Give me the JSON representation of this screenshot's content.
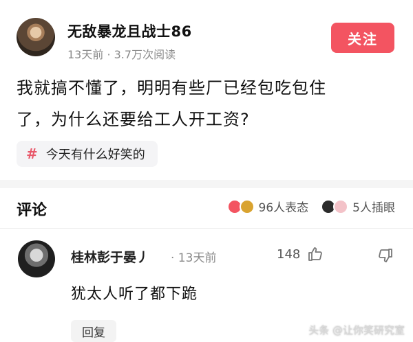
{
  "post": {
    "author_name": "无敌暴龙且战士86",
    "meta": "13天前 · 3.7万次阅读",
    "follow_label": "关注",
    "body_line1": "我就搞不懂了，明明有些厂已经包吃包住",
    "body_line2": "了，为什么还要给工人开工资?",
    "topic_hash": "#",
    "topic": "今天有什么好笑的"
  },
  "comments_section": {
    "title": "评论",
    "reaction_count_label": "96人表态",
    "insert_eye_label": "5人插眼"
  },
  "comment": {
    "user_name": "桂林彭于晏丿",
    "time": "· 13天前",
    "likes": "148",
    "text": "犹太人听了都下跪",
    "reply_label": "回复"
  },
  "watermark": "头条 @让你笑研究室",
  "colors": {
    "follow_bg": "#f35461",
    "topic_hash": "#e8586a",
    "muted_text": "#8a8a8a"
  }
}
